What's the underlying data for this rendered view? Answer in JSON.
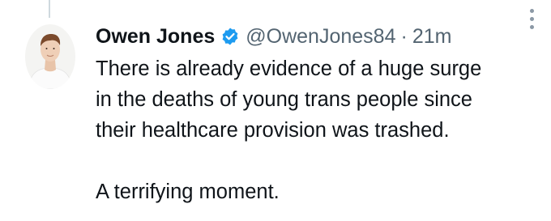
{
  "tweet": {
    "author": {
      "display_name": "Owen Jones",
      "handle": "@OwenJones84",
      "verified": true,
      "verified_color": "#1d9bf0"
    },
    "separator": "·",
    "time": "21m",
    "text_lines": [
      "There is already evidence of a huge surge",
      "in the deaths of young trans people since",
      "their healthcare provision was trashed."
    ],
    "text_last": "A terrifying moment."
  },
  "icons": {
    "verified": "verified-badge-icon",
    "more": "more-options-icon"
  }
}
